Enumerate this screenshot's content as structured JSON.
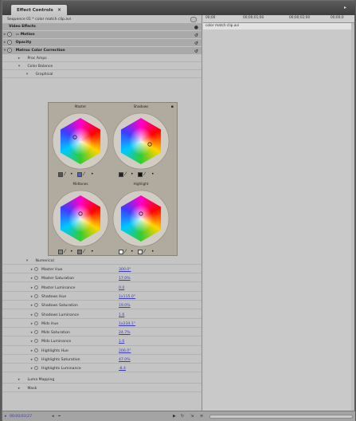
{
  "panel": {
    "tab_label": "Effect Controls",
    "tab_close": "×"
  },
  "sequence_label": "Sequence 01 * color match clip.avi",
  "effects_header": "Video Effects",
  "effects": {
    "motion": "Motion",
    "opacity": "Opacity",
    "color_correction": "Matrox Color Correction"
  },
  "sections": {
    "proc_amps": "Proc Amps",
    "color_balance": "Color Balance",
    "graphical": "Graphical",
    "numerical": "Numerical",
    "luma_mapping": "Luma Mapping",
    "mask": "Mask"
  },
  "wheels": [
    {
      "label": "Master"
    },
    {
      "label": "Shadows"
    },
    {
      "label": "Midtones"
    },
    {
      "label": "Highlight"
    }
  ],
  "params": [
    {
      "label": "Master Hue",
      "value": "300.0°"
    },
    {
      "label": "Master Saturation",
      "value": "17.0%"
    },
    {
      "label": "Master Luminance",
      "value": "0.0"
    },
    {
      "label": "Shadows Hue",
      "value": "1x115.0°"
    },
    {
      "label": "Shadows Saturation",
      "value": "19.0%"
    },
    {
      "label": "Shadows Luminance",
      "value": "1.6"
    },
    {
      "label": "Mids Hue",
      "value": "1x234.1°"
    },
    {
      "label": "Mids Saturation",
      "value": "24.7%"
    },
    {
      "label": "Mids Luminance",
      "value": "1.6"
    },
    {
      "label": "Highlights Hue",
      "value": "206.0°"
    },
    {
      "label": "Highlights Saturation",
      "value": "47.0%"
    },
    {
      "label": "Highlights Luminance",
      "value": "-8.4"
    }
  ],
  "ruler": {
    "t0": "00;00",
    "t1": "00;00;01;00",
    "t2": "00;00;02;00",
    "t3": "00;00;0"
  },
  "clip_name": "color match clip.avi",
  "timecode": "00;00;03;27",
  "colors": {
    "accent": "#3b3bb0",
    "wheel_bg": "#b1ab9f",
    "panel_bg": "#c4c4c4"
  }
}
